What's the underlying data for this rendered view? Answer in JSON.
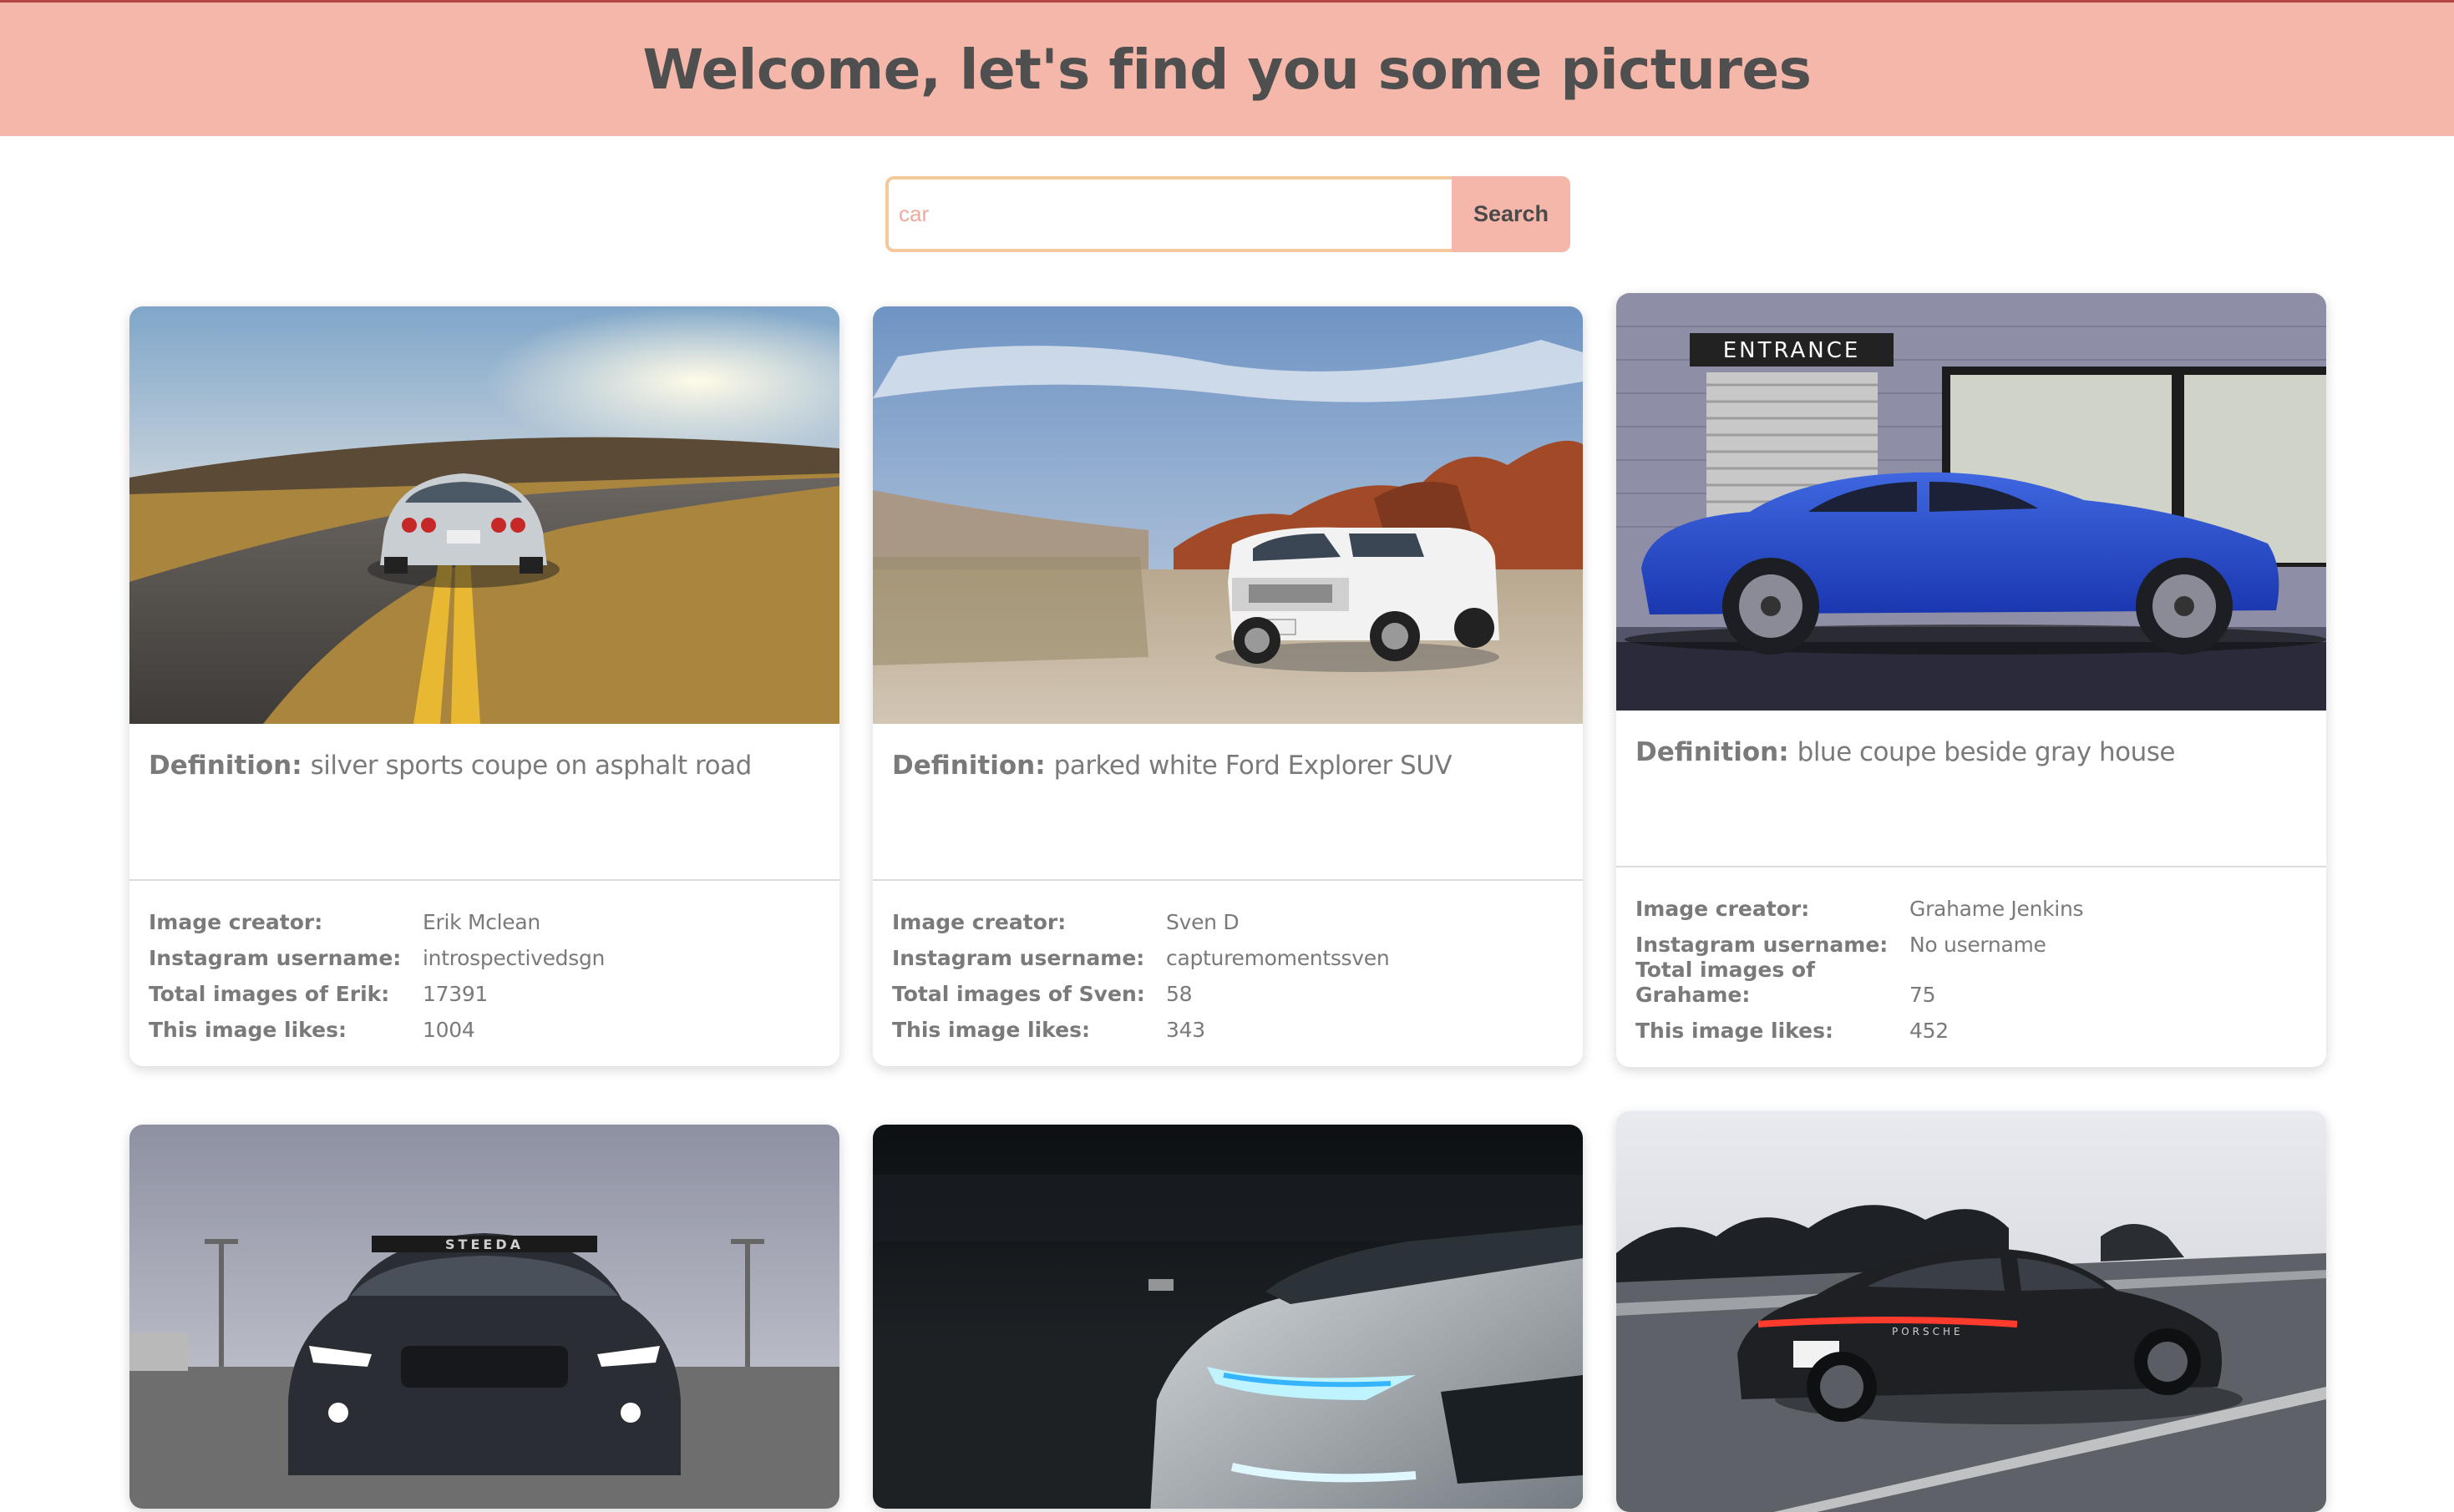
{
  "header": {
    "title": "Welcome, let's find you some pictures"
  },
  "search": {
    "value": "car",
    "button_label": "Search"
  },
  "cards": [
    {
      "definition_label": "Definition:",
      "definition": "silver sports coupe on asphalt road",
      "creator_label": "Image creator:",
      "creator": "Erik Mclean",
      "instagram_label": "Instagram username:",
      "instagram": "introspectivedsgn",
      "total_label": "Total images of Erik:",
      "total": "17391",
      "likes_label": "This image likes:",
      "likes": "1004"
    },
    {
      "definition_label": "Definition:",
      "definition": "parked white Ford Explorer SUV",
      "creator_label": "Image creator:",
      "creator": "Sven D",
      "instagram_label": "Instagram username:",
      "instagram": "capturemomentssven",
      "total_label": "Total images of Sven:",
      "total": "58",
      "likes_label": "This image likes:",
      "likes": "343"
    },
    {
      "definition_label": "Definition:",
      "definition": "blue coupe beside gray house",
      "creator_label": "Image creator:",
      "creator": "Grahame Jenkins",
      "instagram_label": "Instagram username:",
      "instagram": "No username",
      "total_label": "Total images of Grahame:",
      "total": "75",
      "likes_label": "This image likes:",
      "likes": "452"
    }
  ],
  "photo_text": {
    "entrance_sign": "ENTRANCE",
    "steeda_banner": "STEEDA",
    "porsche_badge": "PORSCHE"
  }
}
